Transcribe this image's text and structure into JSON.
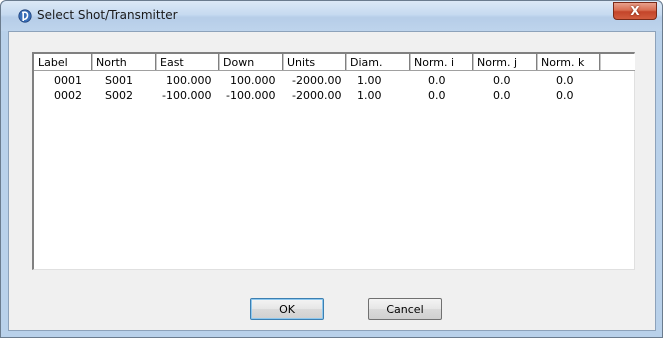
{
  "window": {
    "title": "Select Shot/Transmitter",
    "close_label": "X"
  },
  "table": {
    "columns": [
      "Label",
      "North",
      "East",
      "Down",
      "Units",
      "Diam.",
      "Norm. i",
      "Norm. j",
      "Norm. k"
    ],
    "rows": [
      [
        "0001",
        "S001",
        "100.000",
        "100.000",
        "-2000.00",
        "1.00",
        "0.0",
        "0.0",
        "0.0"
      ],
      [
        "0002",
        "S002",
        "-100.000",
        "-100.000",
        "-2000.00",
        "1.00",
        "0.0",
        "0.0",
        "0.0"
      ]
    ]
  },
  "buttons": {
    "ok_label": "OK",
    "cancel_label": "Cancel"
  },
  "icons": {
    "app": "app-logo-icon",
    "close": "close-icon"
  }
}
